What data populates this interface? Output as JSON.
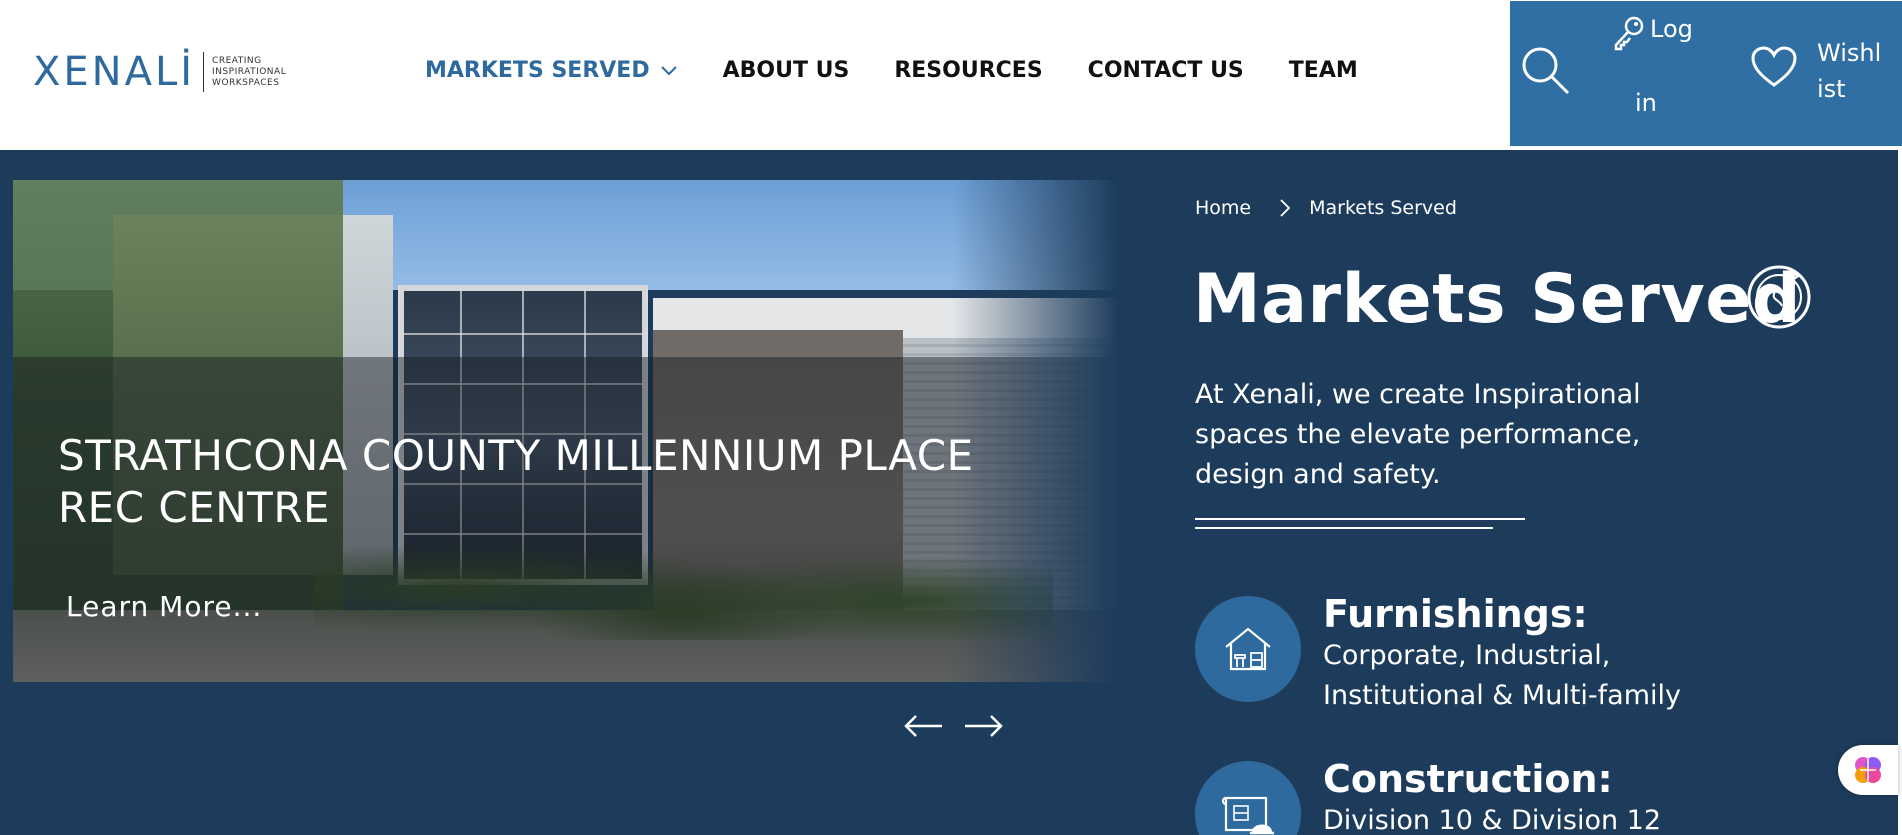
{
  "logo": {
    "wordmark": "XENALİ",
    "tagline": [
      "CREATING",
      "INSPIRATIONAL",
      "WORKSPACES"
    ]
  },
  "nav": {
    "items": [
      {
        "label": "MARKETS SERVED",
        "active": true,
        "has_dropdown": true
      },
      {
        "label": "ABOUT US"
      },
      {
        "label": "RESOURCES"
      },
      {
        "label": "CONTACT US"
      },
      {
        "label": "TEAM"
      }
    ]
  },
  "utility": {
    "search_icon": "search-icon",
    "login_line1": "Log",
    "login_line2": "in",
    "wishlist_label": "Wishlist",
    "wishlist_line1": "Wishl",
    "wishlist_line2": "ist"
  },
  "slider": {
    "caption": "STRATHCONA COUNTY MILLENNIUM PLACE REC CENTRE",
    "learn_more": "Learn More..."
  },
  "breadcrumb": {
    "home": "Home",
    "current": "Markets Served"
  },
  "hero": {
    "title": "Markets Served",
    "intro": "At Xenali, we create Inspirational spaces the elevate performance, design and safety."
  },
  "markets": [
    {
      "title": "Furnishings:",
      "description": "Corporate, Industrial, Institutional & Multi-family",
      "icon": "house-furniture-icon"
    },
    {
      "title": "Construction:",
      "description": "Division 10 & Division 12",
      "icon": "blueprint-helmet-icon"
    }
  ],
  "colors": {
    "brand_blue": "#2e6a9e",
    "utility_blue": "#2f6fa3",
    "navy_band": "#1d3c5c",
    "text_dark": "#111111"
  }
}
